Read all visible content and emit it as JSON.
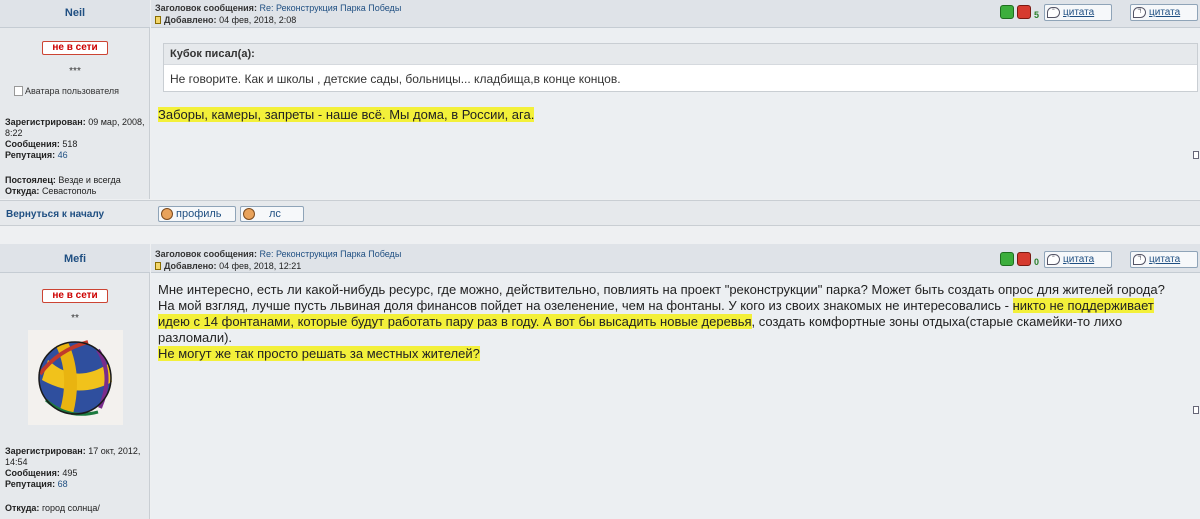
{
  "post1": {
    "author": "Neil",
    "subject_label": "Заголовок сообщения:",
    "subject": "Re: Реконструкция Парка Победы",
    "added_label": "Добавлено:",
    "added": "04 фев, 2018, 2:08",
    "status": "не в сети",
    "stars": "***",
    "avatar_alt": "Аватара пользователя",
    "registered_label": "Зарегистрирован:",
    "registered": "09 мар, 2008, 8:22",
    "messages_label": "Сообщения:",
    "messages": "518",
    "reputation_label": "Репутация:",
    "reputation": "46",
    "resident_label": "Постоялец:",
    "resident": "Везде и всегда",
    "from_label": "Откуда:",
    "from": "Севастополь",
    "rating": "5",
    "quote_btn": "цитата",
    "quote_btn2": "цитата",
    "quote_author": "Кубок писал(а):",
    "quote_text": "Не говорите. Как и школы , детские сады, больницы... кладбища,в конце концов.",
    "message": "Заборы, камеры, запреты - наше всё. Мы дома, в России, ага."
  },
  "bottom": {
    "back_to_top": "Вернуться к началу",
    "profile_btn": "профиль",
    "pm_btn": "лс"
  },
  "post2": {
    "author": "Mefi",
    "subject_label": "Заголовок сообщения:",
    "subject": "Re: Реконструкция Парка Победы",
    "added_label": "Добавлено:",
    "added": "04 фев, 2018, 12:21",
    "status": "не в сети",
    "stars": "**",
    "registered_label": "Зарегистрирован:",
    "registered": "17 окт, 2012, 14:54",
    "messages_label": "Сообщения:",
    "messages": "495",
    "reputation_label": "Репутация:",
    "reputation": "68",
    "from_label": "Откуда:",
    "from": "город солнца/",
    "rating": "0",
    "quote_btn": "цитата",
    "quote_btn2": "цитата",
    "line1": "Мне интересно, есть ли какой-нибудь ресурс, где можно, действительно, повлиять на проект \"реконструкции\" парка? Может быть создать опрос для жителей города?",
    "line2a": "На мой взгляд, лучше пусть львиная доля финансов пойдет на озеленение, чем на фонтаны. У кого из своих знакомых не интересовались - ",
    "line2b": "никто не поддерживает идею с 14 фонтанами, которые будут работать пару раз в году. А вот бы высадить новые деревья",
    "line2c": ", создать комфортные зоны отдыха(старые скамейки-то лихо разломали).",
    "line3": "Не могут же так просто решать за местных жителей?"
  },
  "colors": {
    "highlight": "#f3f03a",
    "link": "#1f4f82",
    "offline": "#cc0000"
  }
}
